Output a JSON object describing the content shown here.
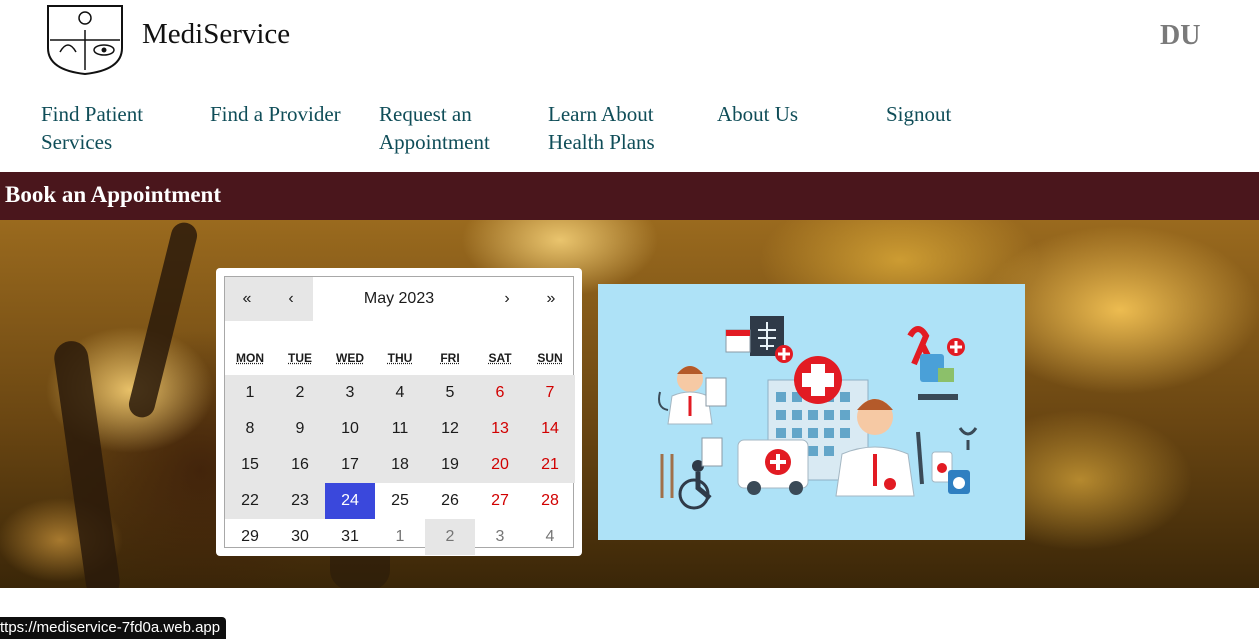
{
  "header": {
    "brand": "MediService",
    "right_text": "DU"
  },
  "nav": [
    {
      "line1": "Find Patient",
      "line2": "Services"
    },
    {
      "line1": "Find a Provider",
      "line2": ""
    },
    {
      "line1": "Request an",
      "line2": "Appointment"
    },
    {
      "line1": "Learn About",
      "line2": "Health Plans"
    },
    {
      "line1": "About Us",
      "line2": ""
    },
    {
      "line1": "Signout",
      "line2": ""
    }
  ],
  "page": {
    "title": "Book an Appointment"
  },
  "calendar": {
    "prev_year": "«",
    "prev_month": "‹",
    "month_label": "May 2023",
    "next_month": "›",
    "next_year": "»",
    "weekdays": [
      "MON",
      "TUE",
      "WED",
      "THU",
      "FRI",
      "SAT",
      "SUN"
    ],
    "days": [
      "1",
      "2",
      "3",
      "4",
      "5",
      "6",
      "7",
      "8",
      "9",
      "10",
      "11",
      "12",
      "13",
      "14",
      "15",
      "16",
      "17",
      "18",
      "19",
      "20",
      "21",
      "22",
      "23",
      "24",
      "25",
      "26",
      "27",
      "28",
      "29",
      "30",
      "31",
      "1",
      "2",
      "3",
      "4"
    ],
    "selected_day": "24"
  },
  "status_bar": {
    "url": "ttps://mediservice-7fd0a.web.app"
  }
}
